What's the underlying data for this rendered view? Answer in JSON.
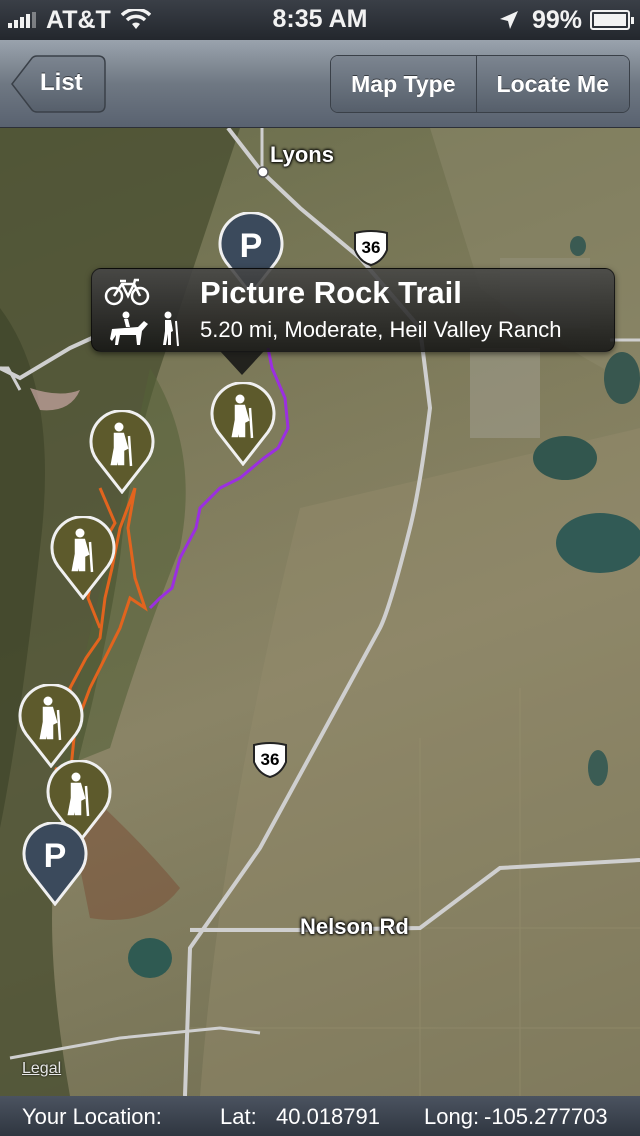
{
  "status_bar": {
    "carrier": "AT&T",
    "time": "8:35 AM",
    "battery": "99%",
    "battery_level": 0.99
  },
  "nav": {
    "back_label": "List",
    "map_type_label": "Map Type",
    "locate_me_label": "Locate Me"
  },
  "map": {
    "labels": {
      "town": "Lyons",
      "road": "Nelson Rd",
      "legal": "Legal"
    },
    "highway_shields": [
      "36",
      "36"
    ],
    "parking_pin_letter": "P",
    "callout": {
      "title": "Picture Rock Trail",
      "subtitle": "5.20 mi, Moderate, Heil Valley Ranch",
      "icons": [
        "bicycle-icon",
        "horse-rider-icon",
        "hiker-icon"
      ]
    },
    "colors": {
      "trail_purple": "#9b2fe0",
      "trail_orange": "#e2641e",
      "pin_olive": "#5d5a2c",
      "pin_parking": "#3b4a5c"
    }
  },
  "location_bar": {
    "label": "Your Location:",
    "lat_label": "Lat:",
    "lat_value": "40.018791",
    "long_label": "Long:",
    "long_value": "-105.277703"
  }
}
